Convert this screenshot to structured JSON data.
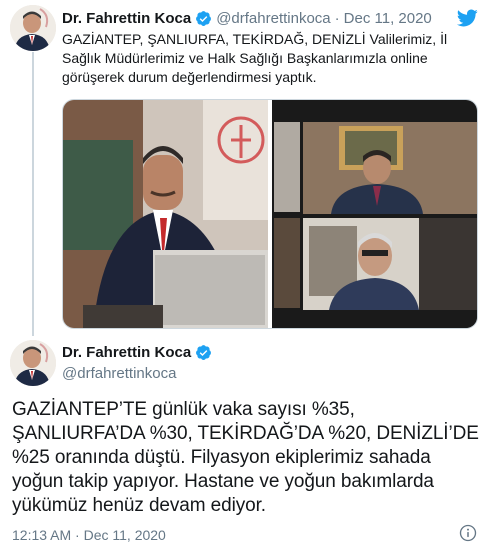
{
  "tweet1": {
    "author_name": "Dr. Fahrettin Koca",
    "handle": "@drfahrettinkoca",
    "separator": "·",
    "date": "Dec 11, 2020",
    "text": "GAZİANTEP, ŞANLIURFA, TEKİRDAĞ, DENİZLİ Valilerimiz, İl Sağlık Müdürlerimiz ve Halk Sağlığı Başkanlarımızla online görüşerek durum değerlendirmesi yaptık.",
    "verified_icon": "verified-badge-icon",
    "brand_icon": "twitter-bird-icon"
  },
  "tweet2": {
    "author_name": "Dr. Fahrettin Koca",
    "handle": "@drfahrettinkoca",
    "text": "GAZİANTEP’TE günlük vaka sayısı %35, ŞANLIURFA’DA %30, TEKİRDAĞ’DA %20, DENİZLİ’DE %25 oranında düştü. Filyasyon ekiplerimiz sahada yoğun takip yapıyor. Hastane ve yoğun bakımlarda yükümüz henüz devam ediyor.",
    "timestamp": "12:13 AM · Dec 11, 2020",
    "info_icon": "info-icon"
  },
  "colors": {
    "verified": "#1da1f2",
    "brand": "#1da1f2",
    "secondary_text": "#657786",
    "thread_line": "#ccd6dd"
  }
}
